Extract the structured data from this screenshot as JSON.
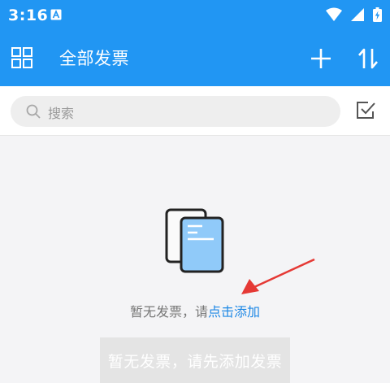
{
  "status_bar": {
    "time": "3:16"
  },
  "app_bar": {
    "title": "全部发票"
  },
  "search": {
    "placeholder": "搜索"
  },
  "empty_state": {
    "message_prefix": "暂无发票，请",
    "link_text": "点击添加"
  },
  "bottom_button": {
    "label": "暂无发票，请先添加发票"
  },
  "colors": {
    "primary": "#2196f3",
    "link": "#1e88e5",
    "annotation_arrow": "#e53935"
  }
}
